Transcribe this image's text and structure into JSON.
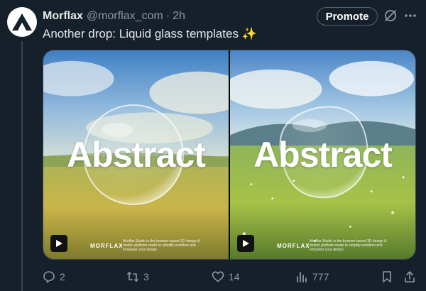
{
  "tweet": {
    "author_name": "Morflax",
    "handle": "@morflax_com",
    "separator": "·",
    "time": "2h",
    "promote_label": "Promote",
    "text": "Another drop: Liquid glass templates ✨",
    "media": [
      {
        "word": "Abstract",
        "brand": "MORFLAX",
        "copy": "Morflax Studio is the browser-based 3D design & motion platform made to simplify workflow and empower your design."
      },
      {
        "word": "Abstract",
        "brand": "MORFLAX",
        "copy": "Morflax Studio is the browser-based 3D design & motion platform made to simplify workflow and empower your design."
      }
    ],
    "actions": {
      "replies": "2",
      "reposts": "3",
      "likes": "14",
      "views": "777"
    }
  },
  "colors": {
    "background": "#15202b",
    "muted": "#8b98a5",
    "border": "#38444d"
  }
}
